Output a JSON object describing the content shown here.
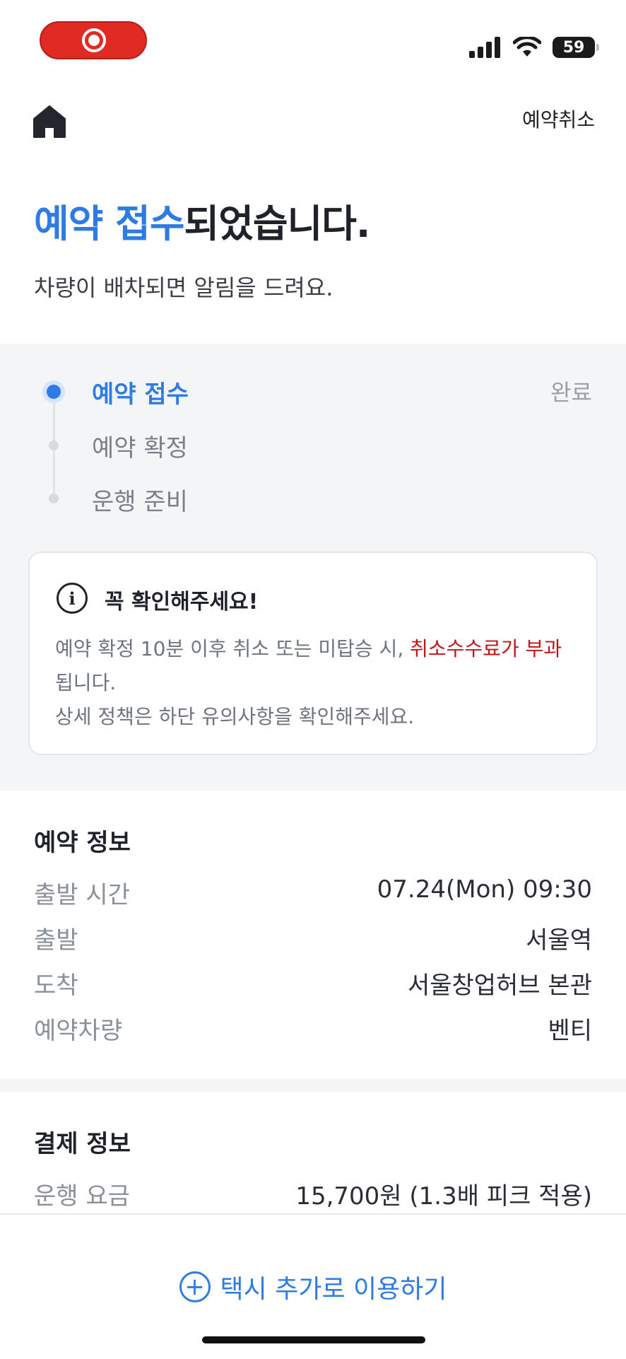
{
  "status_bar": {
    "battery": "59"
  },
  "header": {
    "cancel_label": "예약취소"
  },
  "hero": {
    "title_accent": "예약 접수",
    "title_rest": "되었습니다.",
    "subtitle": "차량이 배차되면 알림을 드려요."
  },
  "progress": {
    "steps": [
      {
        "label": "예약 접수",
        "state": "active"
      },
      {
        "label": "예약 확정",
        "state": "pending"
      },
      {
        "label": "운행 준비",
        "state": "pending"
      }
    ],
    "status": "완료",
    "accent_color": "#2e7be6"
  },
  "notice": {
    "title": "꼭 확인해주세요!",
    "body_part1": "예약 확정 10분 이후 취소 또는 미탑승 시, ",
    "body_warn": "취소수수료가 부과",
    "body_part2": "됩니다.",
    "body_line2": "상세 정책은 하단 유의사항을 확인해주세요.",
    "warn_color": "#c0161a"
  },
  "reservation": {
    "title": "예약 정보",
    "rows": [
      {
        "label": "출발 시간",
        "value": "07.24(Mon) 09:30"
      },
      {
        "label": "출발",
        "value": "서울역"
      },
      {
        "label": "도착",
        "value": "서울창업허브 본관"
      },
      {
        "label": "예약차량",
        "value": "벤티"
      }
    ]
  },
  "payment": {
    "title": "결제 정보",
    "rows": [
      {
        "label": "운행 요금",
        "value": "15,700원 (1.3배 피크 적용)"
      }
    ]
  },
  "bottom": {
    "taxi_button": "택시 추가로 이용하기"
  }
}
